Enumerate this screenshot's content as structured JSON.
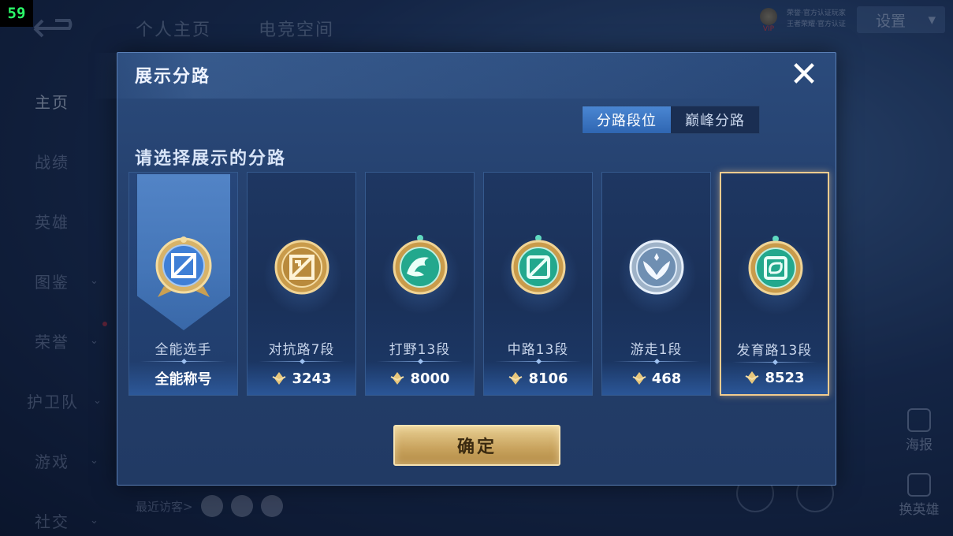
{
  "fps": "59",
  "header": {
    "tabs": [
      "个人主页",
      "电竞空间"
    ],
    "vip_label": "VIP",
    "vip_lines": [
      "荣誉·官方认证玩家",
      "王者荣耀·官方认证"
    ],
    "settings_label": "设置"
  },
  "sidebar": {
    "items": [
      {
        "label": "主页",
        "has_chevron": false
      },
      {
        "label": "战绩",
        "has_chevron": false
      },
      {
        "label": "英雄",
        "has_chevron": false
      },
      {
        "label": "图鉴",
        "has_chevron": true
      },
      {
        "label": "荣誉",
        "has_chevron": true
      },
      {
        "label": "护卫队",
        "has_chevron": true
      },
      {
        "label": "游戏",
        "has_chevron": true
      },
      {
        "label": "社交",
        "has_chevron": true
      }
    ]
  },
  "visitors": {
    "label": "最近访客>"
  },
  "right_buttons": {
    "poster": "海报",
    "switch_hero": "换英雄"
  },
  "modal": {
    "title": "展示分路",
    "close_symbol": "✕",
    "tabs": [
      {
        "label": "分路段位",
        "active": true
      },
      {
        "label": "巅峰分路",
        "active": false
      }
    ],
    "prompt": "请选择展示的分路",
    "cards": [
      {
        "name": "全能选手",
        "footer": "全能称号",
        "emblem": "all-round-emblem-icon",
        "type": "all"
      },
      {
        "name": "对抗路7段",
        "points": "3243",
        "emblem": "clash-lane-emblem-icon",
        "color": "#c69a4a"
      },
      {
        "name": "打野13段",
        "points": "8000",
        "emblem": "jungle-emblem-icon",
        "color": "#2bb79a"
      },
      {
        "name": "中路13段",
        "points": "8106",
        "emblem": "mid-lane-emblem-icon",
        "color": "#2bb79a"
      },
      {
        "name": "游走1段",
        "points": "468",
        "emblem": "roam-emblem-icon",
        "color": "#a9c3dd"
      },
      {
        "name": "发育路13段",
        "points": "8523",
        "emblem": "farm-lane-emblem-icon",
        "color": "#2bb79a",
        "selected": true
      }
    ],
    "confirm_label": "确定"
  }
}
